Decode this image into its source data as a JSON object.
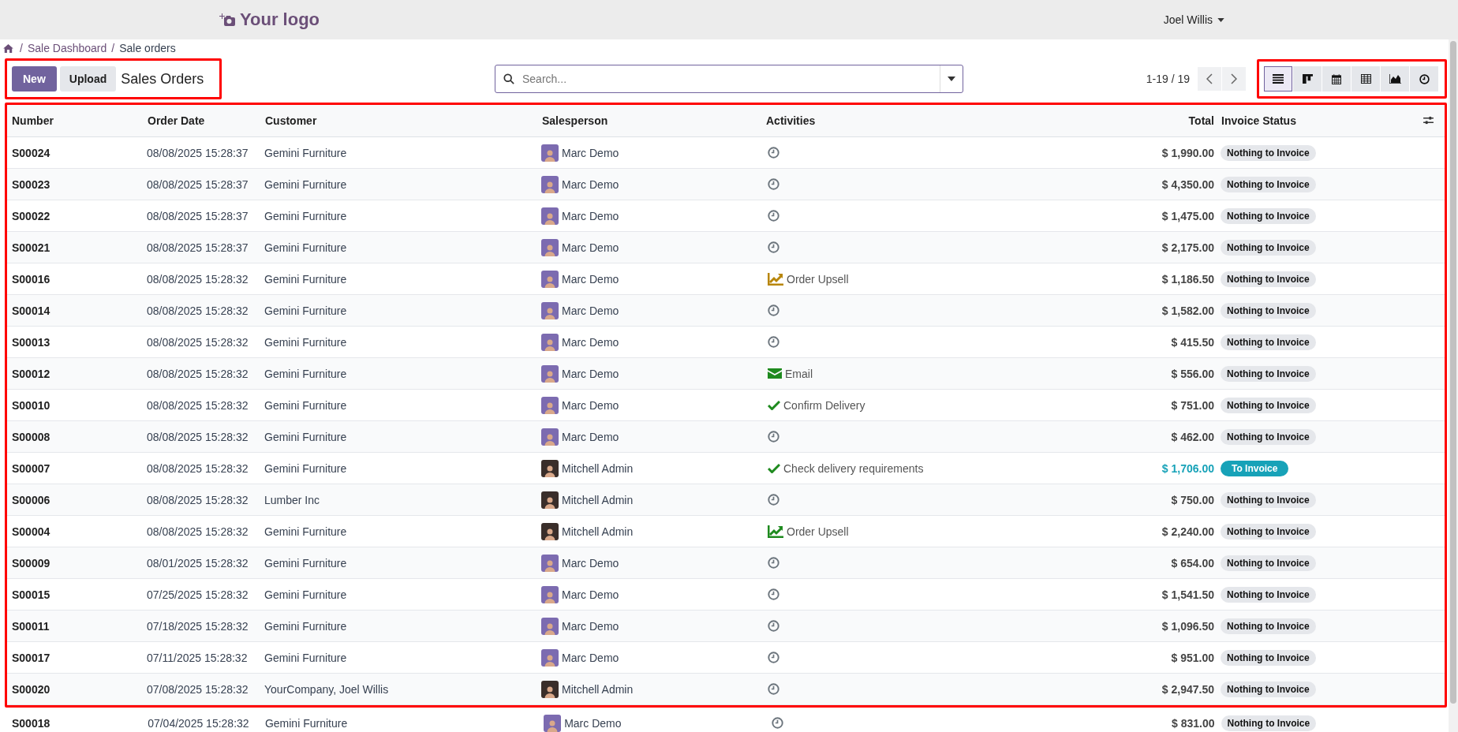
{
  "topbar": {
    "logo": "Your logo",
    "user": "Joel Willis"
  },
  "breadcrumb": {
    "separators": [
      "/",
      "/"
    ],
    "parent": "Sale Dashboard",
    "current": "Sale orders"
  },
  "controls": {
    "new_button": "New",
    "upload_button": "Upload",
    "title": "Sales Orders",
    "search": {
      "placeholder": "Search..."
    },
    "pager": "1-19 / 19",
    "views": [
      {
        "kind": "list",
        "selected": true
      },
      {
        "kind": "kanban",
        "selected": false
      },
      {
        "kind": "calendar",
        "selected": false
      },
      {
        "kind": "pivot",
        "selected": false
      },
      {
        "kind": "graph",
        "selected": false
      },
      {
        "kind": "activity",
        "selected": false
      }
    ]
  },
  "table": {
    "columns": [
      "Number",
      "Order Date",
      "Customer",
      "Salesperson",
      "Activities",
      "Total",
      "Invoice Status"
    ],
    "rows": [
      {
        "number": "S00024",
        "date": "08/08/2025 15:28:37",
        "customer": "Gemini Furniture",
        "salesperson": {
          "name": "Marc Demo",
          "color": "#7c6bb0"
        },
        "activity": {
          "kind": "clock",
          "color": "#6c757d"
        },
        "total": "$ 1,990.00",
        "status": {
          "kind": "nothing",
          "label": "Nothing to Invoice"
        }
      },
      {
        "number": "S00023",
        "date": "08/08/2025 15:28:37",
        "customer": "Gemini Furniture",
        "salesperson": {
          "name": "Marc Demo",
          "color": "#7c6bb0"
        },
        "activity": {
          "kind": "clock",
          "color": "#6c757d"
        },
        "total": "$ 4,350.00",
        "status": {
          "kind": "nothing",
          "label": "Nothing to Invoice"
        }
      },
      {
        "number": "S00022",
        "date": "08/08/2025 15:28:37",
        "customer": "Gemini Furniture",
        "salesperson": {
          "name": "Marc Demo",
          "color": "#7c6bb0"
        },
        "activity": {
          "kind": "clock",
          "color": "#6c757d"
        },
        "total": "$ 1,475.00",
        "status": {
          "kind": "nothing",
          "label": "Nothing to Invoice"
        }
      },
      {
        "number": "S00021",
        "date": "08/08/2025 15:28:37",
        "customer": "Gemini Furniture",
        "salesperson": {
          "name": "Marc Demo",
          "color": "#7c6bb0"
        },
        "activity": {
          "kind": "clock",
          "color": "#6c757d"
        },
        "total": "$ 2,175.00",
        "status": {
          "kind": "nothing",
          "label": "Nothing to Invoice"
        }
      },
      {
        "number": "S00016",
        "date": "08/08/2025 15:28:32",
        "customer": "Gemini Furniture",
        "salesperson": {
          "name": "Marc Demo",
          "color": "#7c6bb0"
        },
        "activity": {
          "kind": "upsell",
          "color": "#b8860b",
          "label": "Order Upsell"
        },
        "total": "$ 1,186.50",
        "status": {
          "kind": "nothing",
          "label": "Nothing to Invoice"
        }
      },
      {
        "number": "S00014",
        "date": "08/08/2025 15:28:32",
        "customer": "Gemini Furniture",
        "salesperson": {
          "name": "Marc Demo",
          "color": "#7c6bb0"
        },
        "activity": {
          "kind": "clock",
          "color": "#6c757d"
        },
        "total": "$ 1,582.00",
        "status": {
          "kind": "nothing",
          "label": "Nothing to Invoice"
        }
      },
      {
        "number": "S00013",
        "date": "08/08/2025 15:28:32",
        "customer": "Gemini Furniture",
        "salesperson": {
          "name": "Marc Demo",
          "color": "#7c6bb0"
        },
        "activity": {
          "kind": "clock",
          "color": "#6c757d"
        },
        "total": "$ 415.50",
        "status": {
          "kind": "nothing",
          "label": "Nothing to Invoice"
        }
      },
      {
        "number": "S00012",
        "date": "08/08/2025 15:28:32",
        "customer": "Gemini Furniture",
        "salesperson": {
          "name": "Marc Demo",
          "color": "#7c6bb0"
        },
        "activity": {
          "kind": "email",
          "color": "#1e8a1e",
          "label": "Email"
        },
        "total": "$ 556.00",
        "status": {
          "kind": "nothing",
          "label": "Nothing to Invoice"
        }
      },
      {
        "number": "S00010",
        "date": "08/08/2025 15:28:32",
        "customer": "Gemini Furniture",
        "salesperson": {
          "name": "Marc Demo",
          "color": "#7c6bb0"
        },
        "activity": {
          "kind": "check",
          "color": "#1e8a1e",
          "label": "Confirm Delivery"
        },
        "total": "$ 751.00",
        "status": {
          "kind": "nothing",
          "label": "Nothing to Invoice"
        }
      },
      {
        "number": "S00008",
        "date": "08/08/2025 15:28:32",
        "customer": "Gemini Furniture",
        "salesperson": {
          "name": "Marc Demo",
          "color": "#7c6bb0"
        },
        "activity": {
          "kind": "clock",
          "color": "#6c757d"
        },
        "total": "$ 462.00",
        "status": {
          "kind": "nothing",
          "label": "Nothing to Invoice"
        }
      },
      {
        "number": "S00007",
        "date": "08/08/2025 15:28:32",
        "customer": "Gemini Furniture",
        "salesperson": {
          "name": "Mitchell Admin",
          "color": "#3a2e2a"
        },
        "activity": {
          "kind": "check",
          "color": "#1e8a1e",
          "label": "Check delivery requirements"
        },
        "total": "$ 1,706.00",
        "status": {
          "kind": "to_invoice",
          "label": "To Invoice"
        }
      },
      {
        "number": "S00006",
        "date": "08/08/2025 15:28:32",
        "customer": "Lumber Inc",
        "salesperson": {
          "name": "Mitchell Admin",
          "color": "#3a2e2a"
        },
        "activity": {
          "kind": "clock",
          "color": "#6c757d"
        },
        "total": "$ 750.00",
        "status": {
          "kind": "nothing",
          "label": "Nothing to Invoice"
        }
      },
      {
        "number": "S00004",
        "date": "08/08/2025 15:28:32",
        "customer": "Gemini Furniture",
        "salesperson": {
          "name": "Mitchell Admin",
          "color": "#3a2e2a"
        },
        "activity": {
          "kind": "upsell",
          "color": "#1e8a1e",
          "label": "Order Upsell"
        },
        "total": "$ 2,240.00",
        "status": {
          "kind": "nothing",
          "label": "Nothing to Invoice"
        }
      },
      {
        "number": "S00009",
        "date": "08/01/2025 15:28:32",
        "customer": "Gemini Furniture",
        "salesperson": {
          "name": "Marc Demo",
          "color": "#7c6bb0"
        },
        "activity": {
          "kind": "clock",
          "color": "#6c757d"
        },
        "total": "$ 654.00",
        "status": {
          "kind": "nothing",
          "label": "Nothing to Invoice"
        }
      },
      {
        "number": "S00015",
        "date": "07/25/2025 15:28:32",
        "customer": "Gemini Furniture",
        "salesperson": {
          "name": "Marc Demo",
          "color": "#7c6bb0"
        },
        "activity": {
          "kind": "clock",
          "color": "#6c757d"
        },
        "total": "$ 1,541.50",
        "status": {
          "kind": "nothing",
          "label": "Nothing to Invoice"
        }
      },
      {
        "number": "S00011",
        "date": "07/18/2025 15:28:32",
        "customer": "Gemini Furniture",
        "salesperson": {
          "name": "Marc Demo",
          "color": "#7c6bb0"
        },
        "activity": {
          "kind": "clock",
          "color": "#6c757d"
        },
        "total": "$ 1,096.50",
        "status": {
          "kind": "nothing",
          "label": "Nothing to Invoice"
        }
      },
      {
        "number": "S00017",
        "date": "07/11/2025 15:28:32",
        "customer": "Gemini Furniture",
        "salesperson": {
          "name": "Marc Demo",
          "color": "#7c6bb0"
        },
        "activity": {
          "kind": "clock",
          "color": "#6c757d"
        },
        "total": "$ 951.00",
        "status": {
          "kind": "nothing",
          "label": "Nothing to Invoice"
        }
      },
      {
        "number": "S00020",
        "date": "07/08/2025 15:28:32",
        "customer": "YourCompany, Joel Willis",
        "salesperson": {
          "name": "Mitchell Admin",
          "color": "#3a2e2a"
        },
        "activity": {
          "kind": "clock",
          "color": "#6c757d"
        },
        "total": "$ 2,947.50",
        "status": {
          "kind": "nothing",
          "label": "Nothing to Invoice"
        }
      },
      {
        "number": "S00018",
        "date": "07/04/2025 15:28:32",
        "customer": "Gemini Furniture",
        "salesperson": {
          "name": "Marc Demo",
          "color": "#7c6bb0"
        },
        "activity": {
          "kind": "clock",
          "color": "#6c757d"
        },
        "total": "$ 831.00",
        "status": {
          "kind": "nothing",
          "label": "Nothing to Invoice"
        }
      }
    ]
  }
}
